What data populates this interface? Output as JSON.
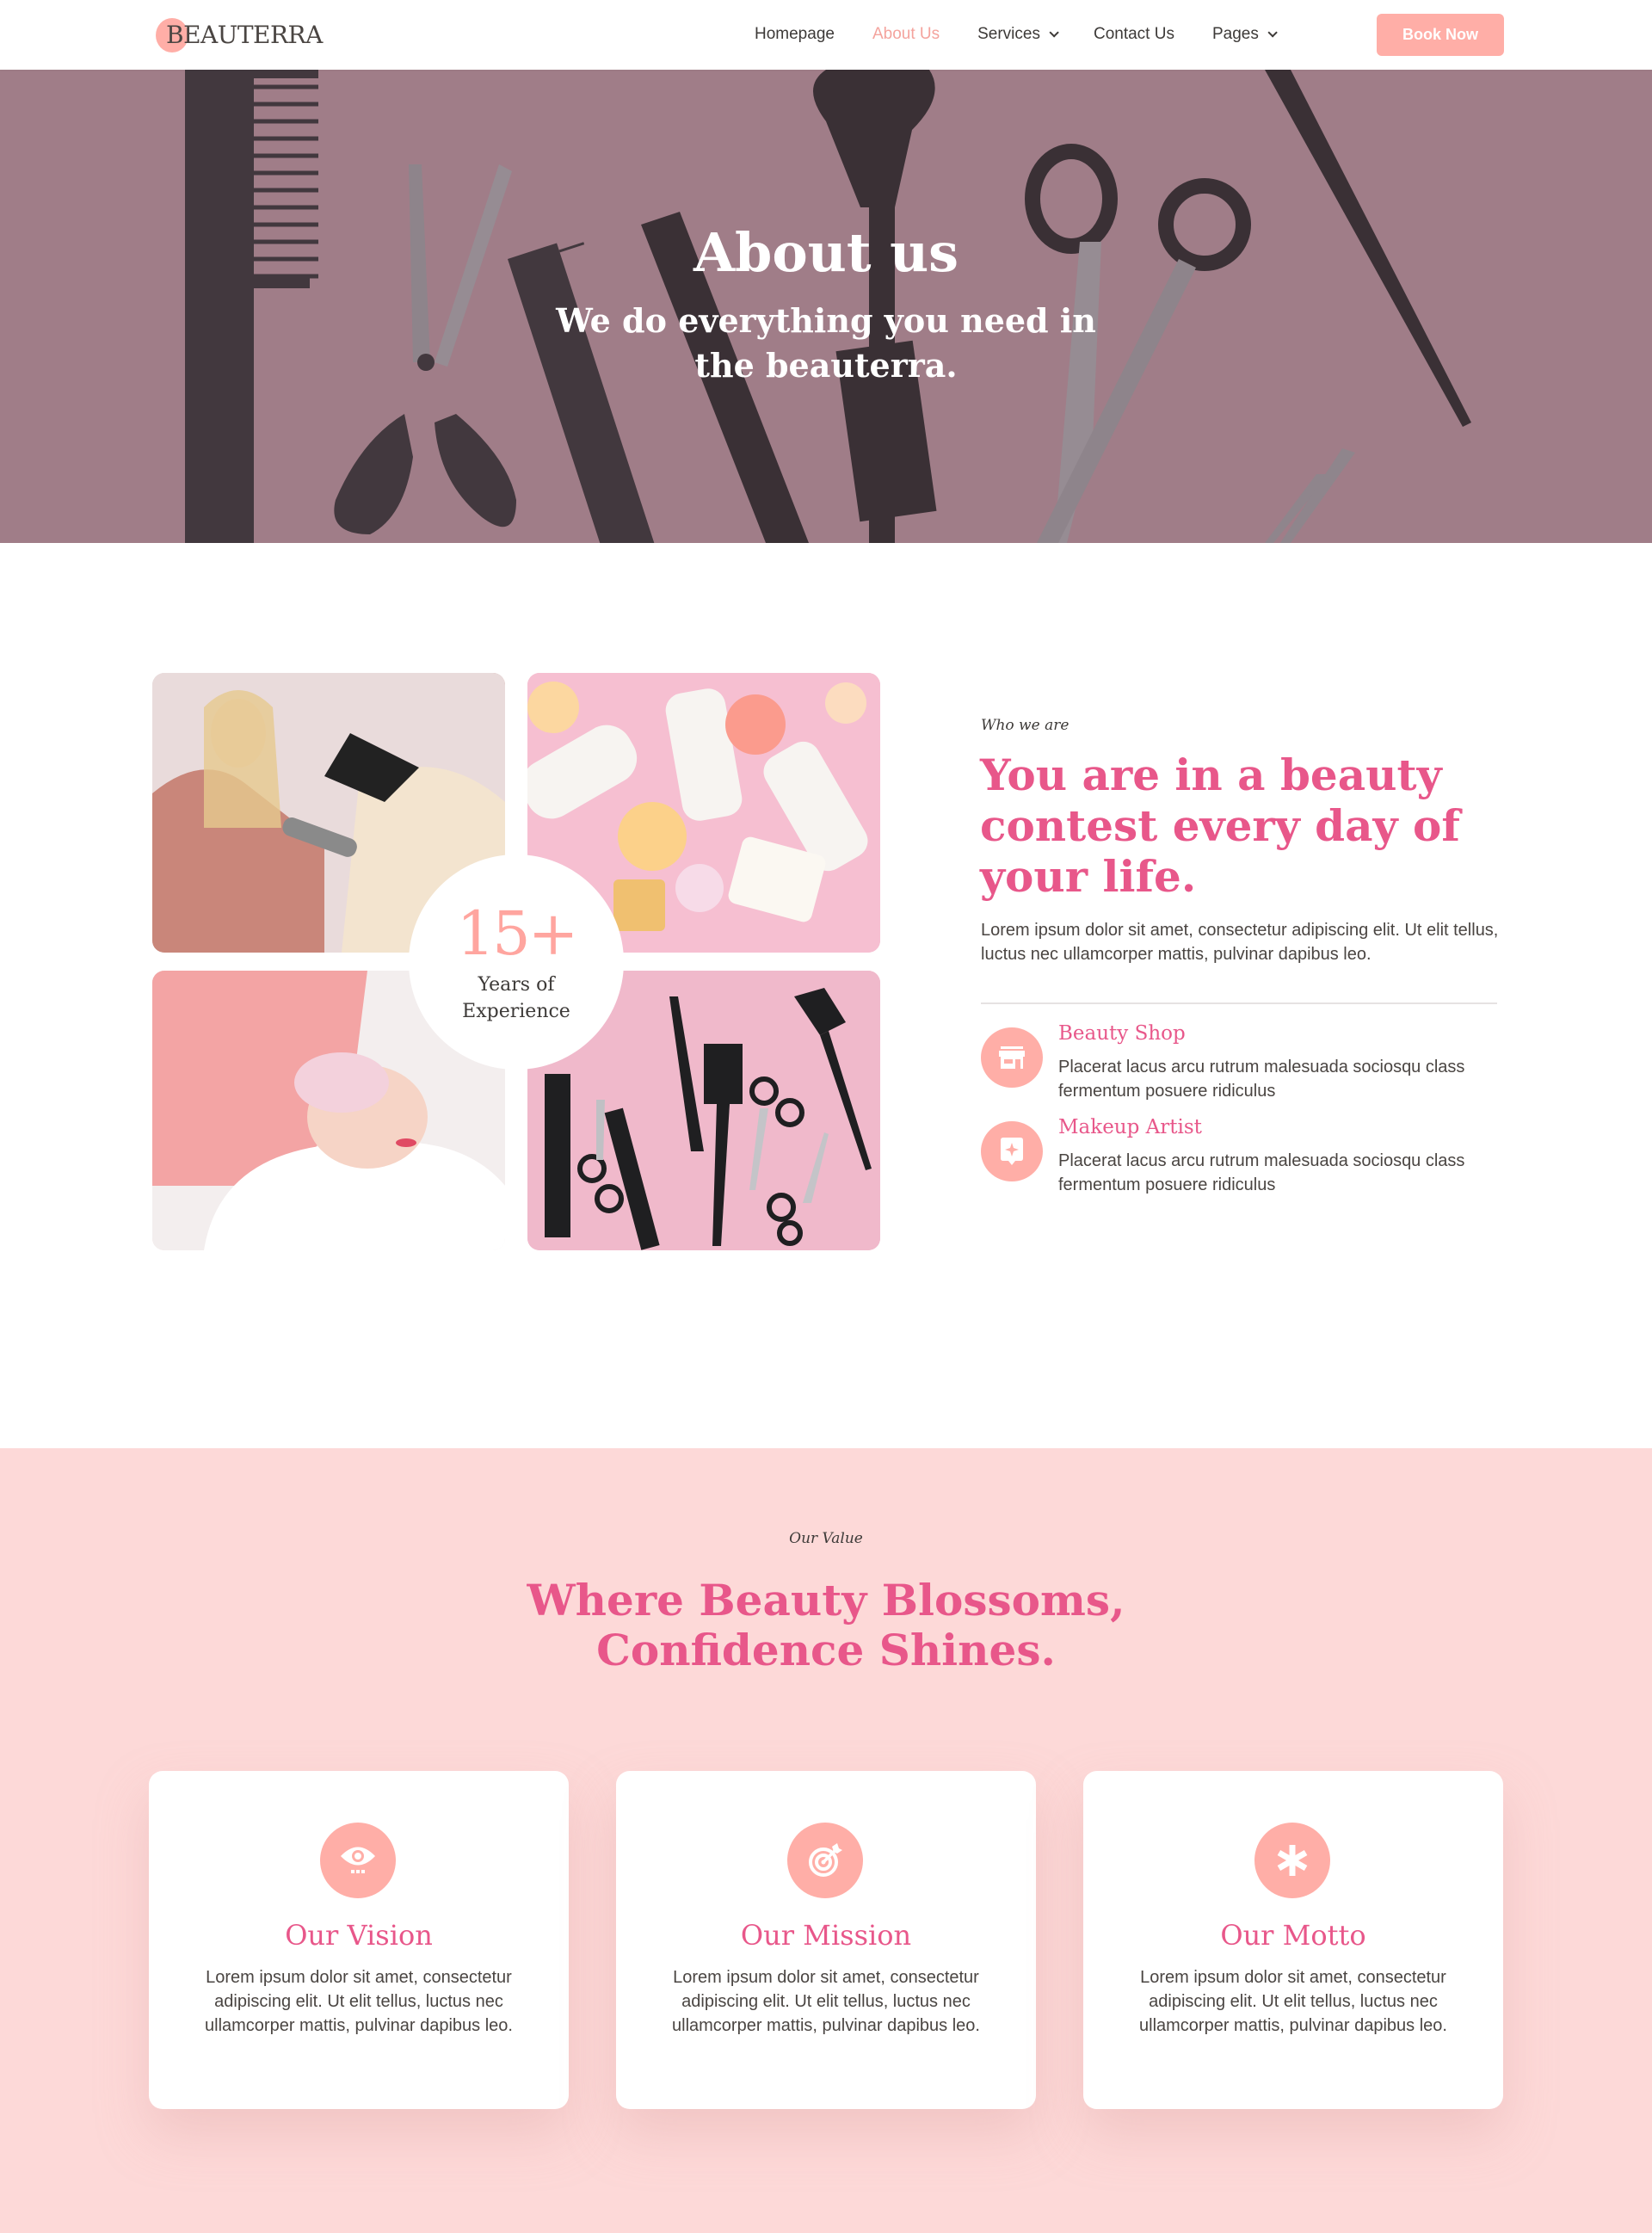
{
  "header": {
    "logo": "BEAUTERRA",
    "nav": [
      {
        "label": "Homepage",
        "active": false,
        "dropdown": false
      },
      {
        "label": "About Us",
        "active": true,
        "dropdown": false
      },
      {
        "label": "Services",
        "active": false,
        "dropdown": true
      },
      {
        "label": "Contact Us",
        "active": false,
        "dropdown": false
      },
      {
        "label": "Pages",
        "active": false,
        "dropdown": true
      }
    ],
    "cta": "Book Now"
  },
  "hero": {
    "title": "About us",
    "subtitle": "We do everything you need in the beauterra."
  },
  "about": {
    "photos": [
      {
        "alt": "stylist-blow-drying-hair"
      },
      {
        "alt": "spa-towels-and-soaps"
      },
      {
        "alt": "facial-massage-treatment"
      },
      {
        "alt": "hair-tools-on-pink"
      }
    ],
    "experience": {
      "number": "15+",
      "label": "Years of Experience"
    },
    "kicker": "Who we are",
    "title": "You are in a beauty contest every day of your life.",
    "description": "Lorem ipsum dolor sit amet, consectetur adipiscing elit. Ut elit tellus, luctus nec ullamcorper mattis, pulvinar dapibus leo.",
    "features": [
      {
        "icon": "store-icon",
        "title": "Beauty Shop",
        "description": "Placerat lacus arcu rutrum malesuada sociosqu class fermentum posuere ridiculus"
      },
      {
        "icon": "sparkle-badge-icon",
        "title": "Makeup Artist",
        "description": "Placerat lacus arcu rutrum malesuada sociosqu class fermentum posuere ridiculus"
      }
    ]
  },
  "values": {
    "kicker": "Our Value",
    "title": "Where Beauty Blossoms, Confidence Shines.",
    "cards": [
      {
        "icon": "eye-icon",
        "title": "Our Vision",
        "description": "Lorem ipsum dolor sit amet, consectetur adipiscing elit. Ut elit tellus, luctus nec ullamcorper mattis, pulvinar dapibus leo."
      },
      {
        "icon": "target-icon",
        "title": "Our Mission",
        "description": "Lorem ipsum dolor sit amet, consectetur adipiscing elit. Ut elit tellus, luctus nec ullamcorper mattis, pulvinar dapibus leo."
      },
      {
        "icon": "asterisk-icon",
        "title": "Our Motto",
        "description": "Lorem ipsum dolor sit amet, consectetur adipiscing elit. Ut elit tellus, luctus nec ullamcorper mattis, pulvinar dapibus leo."
      }
    ]
  },
  "colors": {
    "accent_pink": "#e8578a",
    "soft_coral": "#ffaea7",
    "section_bg": "#fdd9d8",
    "text_dark": "#4a4542"
  }
}
